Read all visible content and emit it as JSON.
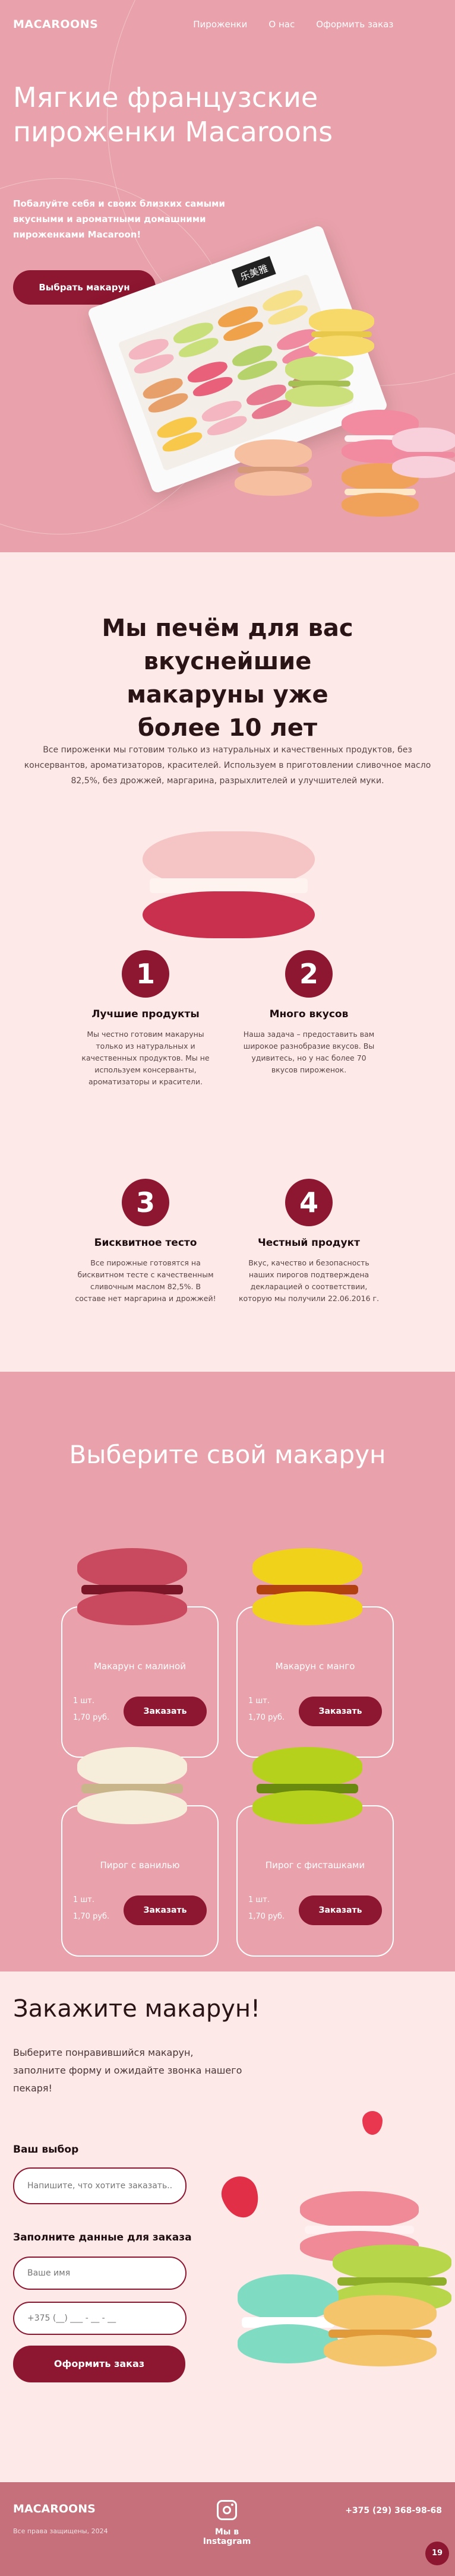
{
  "header": {
    "logo": "MACAROONS",
    "nav": [
      "Пироженки",
      "О нас",
      "Оформить заказ"
    ]
  },
  "hero": {
    "title": "Мягкие французские пироженки Macaroons",
    "lead": "Побалуйте себя и своих близких самыми вкусными и ароматными домашними пироженками Macaroon!",
    "cta": "Выбрать макарун",
    "box_label": "乐美雅"
  },
  "about": {
    "title": "Мы печём для вас вкуснейшие макаруны уже более 10 лет",
    "text": "Все пироженки мы готовим только из натуральных и качественных продуктов, без консервантов, ароматизаторов, красителей. Используем в приготовлении сливочное масло 82,5%, без дрожжей, маргарина, разрыхлителей и улучшителей муки.",
    "features": [
      {
        "num": "1",
        "title": "Лучшие продукты",
        "text": "Мы честно готовим макаруны только из натуральных и качественных продуктов. Мы не используем консерванты, ароматизаторы и красители."
      },
      {
        "num": "2",
        "title": "Много вкусов",
        "text": "Наша задача – предоставить вам широкое разнобразие вкусов. Вы удивитесь, но у нас более 70 вкусов пироженок."
      },
      {
        "num": "3",
        "title": "Бисквитное тесто",
        "text": "Все пирожные готовятся на бисквитном тесте с качественным сливочным маслом 82,5%. В составе нет маргарина и дрожжей!"
      },
      {
        "num": "4",
        "title": "Честный продукт",
        "text": "Вкус, качество и безопасность наших пирогов подтверждена декларацией о соответствии, которую мы получили 22.06.2016 г."
      }
    ]
  },
  "catalog": {
    "title": "Выберите свой макарун",
    "items": [
      {
        "name": "Макарун с малиной",
        "qty": "1 шт.",
        "price": "1,70 руб.",
        "button": "Заказать",
        "color_top": "#c94a5e",
        "color_fill": "#7a1628"
      },
      {
        "name": "Макарун с манго",
        "qty": "1 шт.",
        "price": "1,70 руб.",
        "button": "Заказать",
        "color_top": "#f0d21a",
        "color_fill": "#b3400f"
      },
      {
        "name": "Пирог с ванилью",
        "qty": "1 шт.",
        "price": "1,70 руб.",
        "button": "Заказать",
        "color_top": "#f6eedb",
        "color_fill": "#c8b58a"
      },
      {
        "name": "Пирог с фисташками",
        "qty": "1 шт.",
        "price": "1,70 руб.",
        "button": "Заказать",
        "color_top": "#b6d11c",
        "color_fill": "#6a8a0f"
      }
    ]
  },
  "order": {
    "title": "Закажите макарун!",
    "desc": "Выберите понравившийся макарун, заполните форму и ожидайте звонка нашего пекаря!",
    "choice_label": "Ваш выбор",
    "choice_placeholder": "Напишите, что хотите заказать...",
    "contacts_label": "Заполните данные для заказа",
    "name_placeholder": "Ваше имя",
    "phone_placeholder": "+375 (__) ___ - __ - __",
    "submit": "Оформить заказ"
  },
  "footer": {
    "logo": "MACAROONS",
    "copy": "Все права защищены, 2024",
    "instagram": "Мы в Instagram",
    "phone": "+375 (29) 368-98-68",
    "badge": "19"
  },
  "colors": {
    "pink": "#e9a2ab",
    "cream": "#fde9e8",
    "accent": "#8d1630"
  }
}
